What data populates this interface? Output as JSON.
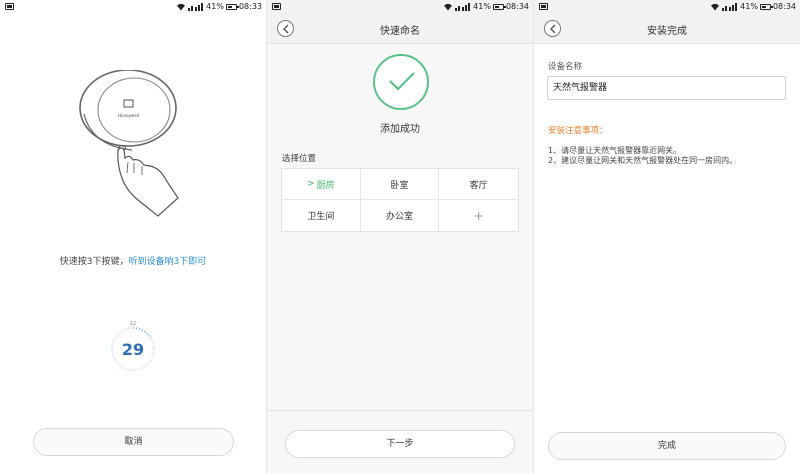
{
  "statusbar": {
    "screen1": {
      "battery": "41%",
      "time": "08:33"
    },
    "screen2": {
      "battery": "41%",
      "time": "08:34"
    },
    "screen3": {
      "battery": "41%",
      "time": "08:34"
    }
  },
  "screen1": {
    "device_logo_text": "Honeywell",
    "hint_prefix": "快速按3下按键，",
    "hint_highlight": "听到设备响3下即可",
    "countdown_top": "12",
    "countdown": "29",
    "cancel_label": "取消"
  },
  "screen2": {
    "title": "快速命名",
    "success_text": "添加成功",
    "location_label": "选择位置",
    "locations": [
      {
        "label": "厨房",
        "selected": true
      },
      {
        "label": "卧室",
        "selected": false
      },
      {
        "label": "客厅",
        "selected": false
      },
      {
        "label": "卫生间",
        "selected": false
      },
      {
        "label": "办公室",
        "selected": false
      }
    ],
    "add_symbol": "+",
    "selected_chevron": ">",
    "next_label": "下一步"
  },
  "screen3": {
    "title": "安装完成",
    "field_label": "设备名称",
    "field_value": "天然气报警器",
    "notes_title": "安装注意事项：",
    "notes": [
      "1、请尽量让天然气报警器靠近网关。",
      "2、建议尽量让网关和天然气报警器处在同一房间内。"
    ],
    "done_label": "完成"
  },
  "colors": {
    "accent_green": "#3fb66c",
    "accent_blue": "#2f8fd1",
    "warning_orange": "#f07c2a"
  }
}
